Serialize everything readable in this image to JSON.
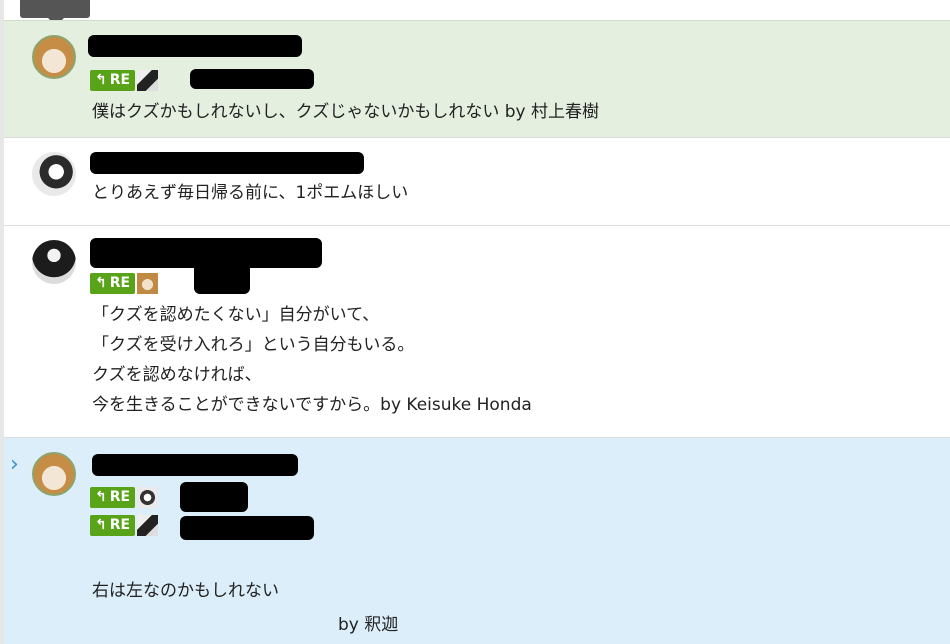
{
  "posts": [
    {
      "retweet_label": "RE",
      "text": "僕はクズかもしれないし、クズじゃないかもしれない by 村上春樹"
    },
    {
      "text": "とりあえず毎日帰る前に、1ポエムほしい"
    },
    {
      "retweet_label": "RE",
      "lines": [
        "「クズを認めたくない」自分がいて、",
        "「クズを受け入れろ」という自分もいる。",
        "クズを認めなければ、",
        "今を生きることができないですから。by Keisuke Honda"
      ]
    },
    {
      "retweet_labels": [
        "RE",
        "RE"
      ],
      "lines": [
        "右は左なのかもしれない",
        "by 釈迦"
      ]
    }
  ],
  "icons": {
    "reply": "reply-arrow-icon",
    "chevron": "chevron-right-icon"
  },
  "colors": {
    "mine_bg": "#e4efe0",
    "focused_bg": "#dbeefa",
    "re_badge": "#58a317",
    "chevron": "#3a8fd0"
  }
}
